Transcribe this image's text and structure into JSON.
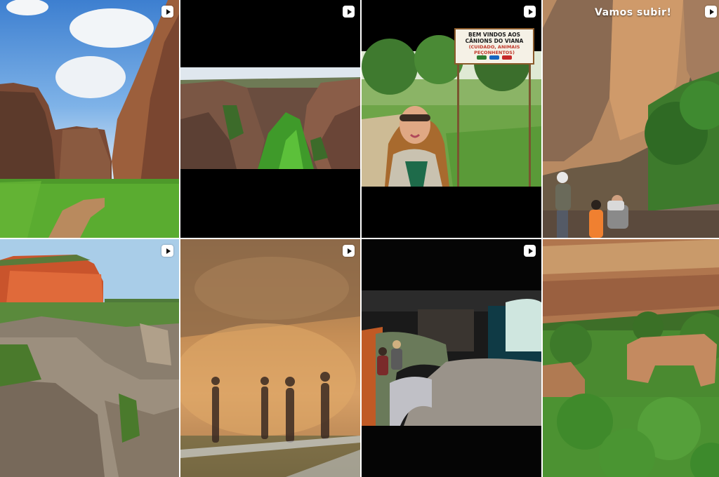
{
  "grid": {
    "tiles": [
      {
        "id": "tile-1",
        "kind": "video",
        "subject": "canyon-trail"
      },
      {
        "id": "tile-2",
        "kind": "video",
        "subject": "canyon-aerial"
      },
      {
        "id": "tile-3",
        "kind": "video",
        "subject": "welcome-sign-selfie",
        "sign": {
          "line1": "BEM VINDOS AOS",
          "line2": "CÂNIONS DO VIANA",
          "line3": "(CUIDADO, ANIMAIS",
          "line4": "PEÇONHENTOS)"
        }
      },
      {
        "id": "tile-4",
        "kind": "video",
        "subject": "hikers-cliff",
        "overlay_text": "Vamos subir!"
      },
      {
        "id": "tile-5",
        "kind": "video",
        "subject": "mesa-landscape"
      },
      {
        "id": "tile-6",
        "kind": "video",
        "subject": "rock-art-shadows"
      },
      {
        "id": "tile-7",
        "kind": "video",
        "subject": "museum-interior"
      },
      {
        "id": "tile-8",
        "kind": "image",
        "subject": "rock-arch-forest"
      }
    ],
    "badge_icon": "play-video-icon"
  }
}
